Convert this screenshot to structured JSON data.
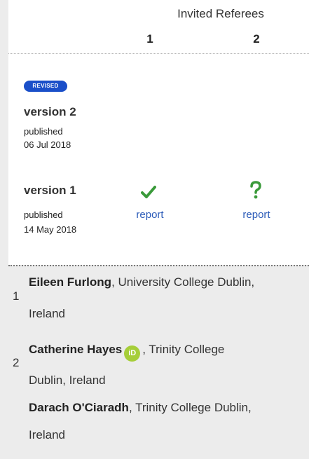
{
  "header": {
    "invited_referees": "Invited Referees",
    "referee_numbers": [
      "1",
      "2"
    ]
  },
  "versions": [
    {
      "badge": "REVISED",
      "title": "version 2",
      "status": "published",
      "date": "06 Jul 2018"
    },
    {
      "title": "version 1",
      "status": "published",
      "date": "14 May 2018",
      "reports": [
        {
          "icon": "check-icon",
          "label": "report",
          "color": "#3a9a3a"
        },
        {
          "icon": "question-icon",
          "label": "report",
          "color": "#3a9a3a"
        }
      ]
    }
  ],
  "referees": [
    {
      "index": "1",
      "people": [
        {
          "name": "Eileen Furlong",
          "affiliation_line1": ", University College Dublin,",
          "affiliation_line2": "Ireland"
        }
      ]
    },
    {
      "index": "2",
      "people": [
        {
          "name": "Catherine Hayes",
          "orcid": "iD",
          "affiliation_line1": ", Trinity College",
          "affiliation_line2": "Dublin, Ireland"
        },
        {
          "name": "Darach O'Ciaradh",
          "affiliation_line1": ", Trinity College Dublin,",
          "affiliation_line2": "Ireland"
        }
      ]
    }
  ],
  "colors": {
    "badge": "#1a4fc9",
    "link": "#2a5ab8",
    "status_ok": "#3a9a3a",
    "orcid": "#a6ce39"
  }
}
